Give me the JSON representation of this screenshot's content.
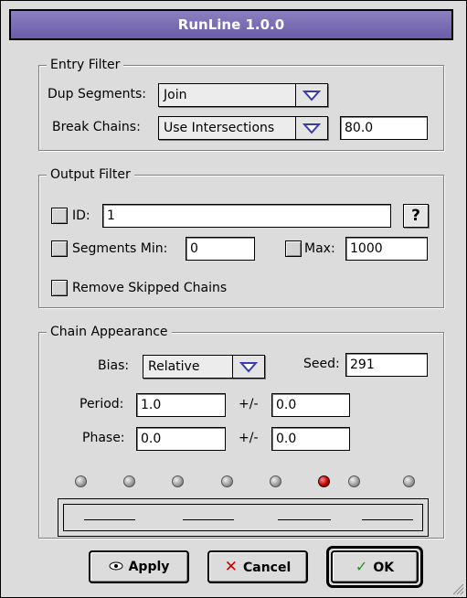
{
  "window": {
    "title": "RunLine 1.0.0"
  },
  "entry_filter": {
    "title": "Entry Filter",
    "dup_segments": {
      "label": "Dup Segments:",
      "value": "Join"
    },
    "break_chains": {
      "label": "Break Chains:",
      "value": "Use Intersections",
      "amount": "80.0"
    }
  },
  "output_filter": {
    "title": "Output Filter",
    "id": {
      "label": "ID:",
      "value": "1",
      "checked": false,
      "help": "?"
    },
    "segments_min": {
      "label": "Segments Min:",
      "value": "0",
      "checked": false
    },
    "max": {
      "label": "Max:",
      "value": "1000",
      "checked": false
    },
    "remove_skipped": {
      "label": "Remove Skipped Chains",
      "checked": false
    }
  },
  "chain_appearance": {
    "title": "Chain Appearance",
    "bias": {
      "label": "Bias:",
      "value": "Relative"
    },
    "seed": {
      "label": "Seed:",
      "value": "291"
    },
    "period": {
      "label": "Period:",
      "value": "1.0",
      "pm_label": "+/-",
      "pm_value": "0.0"
    },
    "phase": {
      "label": "Phase:",
      "value": "0.0",
      "pm_label": "+/-",
      "pm_value": "0.0"
    },
    "preview_dots_count": 8,
    "active_dot_index": 5
  },
  "buttons": {
    "apply": "Apply",
    "cancel": "Cancel",
    "ok": "OK"
  },
  "colors": {
    "title_bar": "#6a5ca8",
    "active_dot": "#c00000",
    "popup_arrow": "#3a3ab0",
    "ok_check": "#2e8b2e",
    "cancel_x": "#cc0000"
  }
}
